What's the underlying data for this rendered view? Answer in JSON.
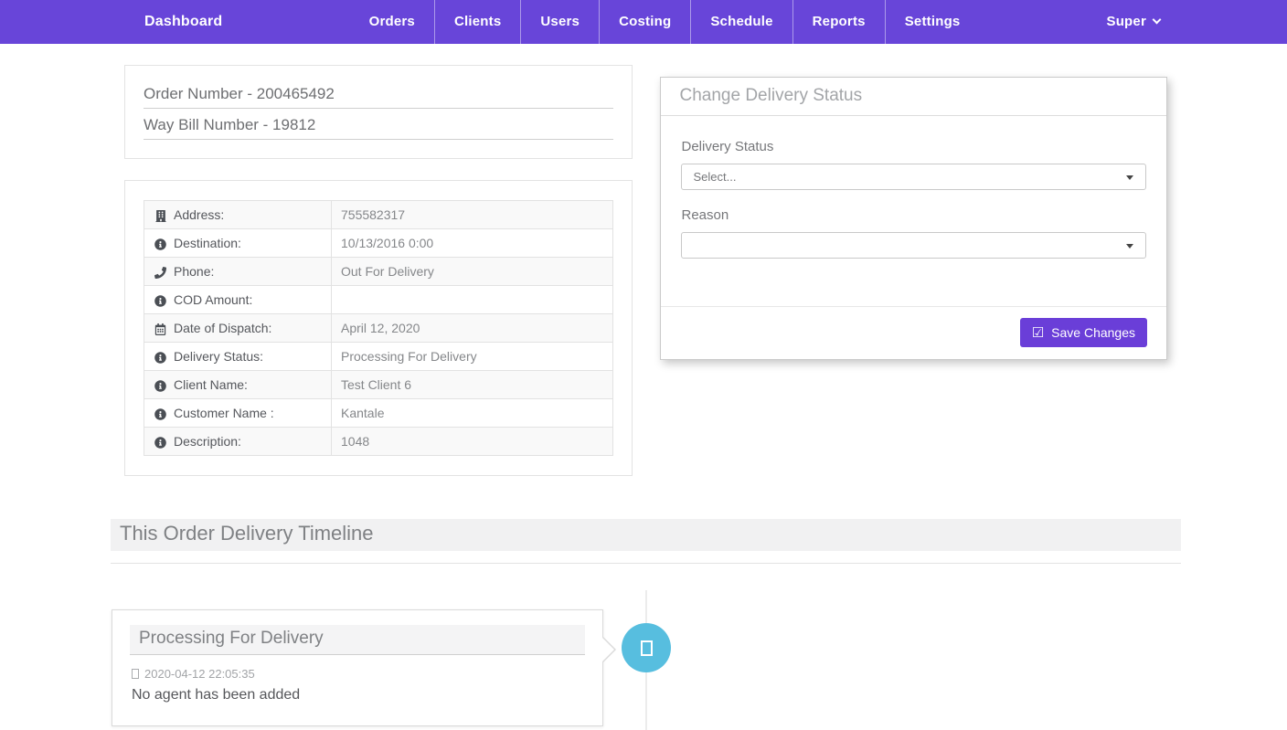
{
  "navbar": {
    "brand": "Dashboard",
    "items": [
      "Orders",
      "Clients",
      "Users",
      "Costing",
      "Schedule",
      "Reports",
      "Settings"
    ],
    "user_menu": "Super"
  },
  "order_panel": {
    "order_number": "Order Number - 200465492",
    "waybill_number": "Way Bill Number - 19812"
  },
  "details_table": {
    "rows": [
      {
        "icon": "building-icon",
        "label": "Address:",
        "value": "755582317"
      },
      {
        "icon": "info-circle-icon",
        "label": "Destination:",
        "value": "10/13/2016 0:00"
      },
      {
        "icon": "phone-icon",
        "label": "Phone:",
        "value": "Out For Delivery"
      },
      {
        "icon": "info-circle-icon",
        "label": "COD Amount:",
        "value": ""
      },
      {
        "icon": "calendar-icon",
        "label": "Date of Dispatch:",
        "value": "April 12, 2020"
      },
      {
        "icon": "info-circle-icon",
        "label": "Delivery Status:",
        "value": "Processing For Delivery"
      },
      {
        "icon": "info-circle-icon",
        "label": "Client Name:",
        "value": "Test Client 6"
      },
      {
        "icon": "info-circle-icon",
        "label": "Customer Name :",
        "value": "Kantale"
      },
      {
        "icon": "info-circle-icon",
        "label": "Description:",
        "value": "1048"
      }
    ]
  },
  "status_panel": {
    "title": "Change Delivery Status",
    "delivery_status_label": "Delivery Status",
    "delivery_status_value": "Select...",
    "reason_label": "Reason",
    "reason_value": "",
    "save_button_label": "Save Changes"
  },
  "timeline": {
    "heading": "This Order Delivery Timeline",
    "entries": [
      {
        "title": "Processing For Delivery",
        "timestamp": "2020-04-12 22:05:35",
        "note": "No agent has been added"
      }
    ]
  },
  "colors": {
    "navbar_purple": "#6845d9",
    "button_purple": "#6a3ed8",
    "badge_teal": "#57bedf"
  }
}
